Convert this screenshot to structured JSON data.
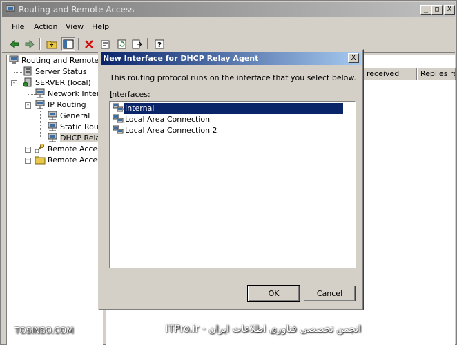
{
  "window": {
    "title": "Routing and Remote Access",
    "caption_buttons": {
      "minimize": "_",
      "maximize": "□",
      "close": "X"
    }
  },
  "menubar": {
    "file": "File",
    "action": "Action",
    "view": "View",
    "help": "Help"
  },
  "toolbar": {
    "icons": [
      "back-arrow-icon",
      "forward-arrow-icon",
      "up-folder-icon",
      "show-hide-tree-icon",
      "delete-icon",
      "properties-icon",
      "refresh-icon",
      "export-list-icon",
      "help-icon"
    ]
  },
  "tree": {
    "root": "Routing and Remote Ac",
    "server_status": "Server Status",
    "server": "SERVER (local)",
    "network_interfaces": "Network Interf",
    "ip_routing": "IP Routing",
    "general": "General",
    "static_routes": "Static Rout",
    "dhcp_relay": "DHCP Relay",
    "remote_access_1": "Remote Access",
    "remote_access_2": "Remote Access"
  },
  "right_pane": {
    "columns": [
      "received",
      "Replies rec"
    ]
  },
  "dialog": {
    "title": "New Interface for DHCP Relay Agent",
    "close": "X",
    "description": "This routing protocol runs on the interface that you select below.",
    "interfaces_label_accel": "I",
    "interfaces_label_rest": "nterfaces:",
    "interfaces": [
      {
        "name": "Internal",
        "selected": true
      },
      {
        "name": "Local Area Connection",
        "selected": false
      },
      {
        "name": "Local Area Connection 2",
        "selected": false
      }
    ],
    "ok_label": "OK",
    "cancel_label": "Cancel"
  },
  "watermark": {
    "left": "TOSINSO.COM",
    "right": "انجمن تخصصی فناوری اطلاعات ایران - ITPro.ir"
  }
}
